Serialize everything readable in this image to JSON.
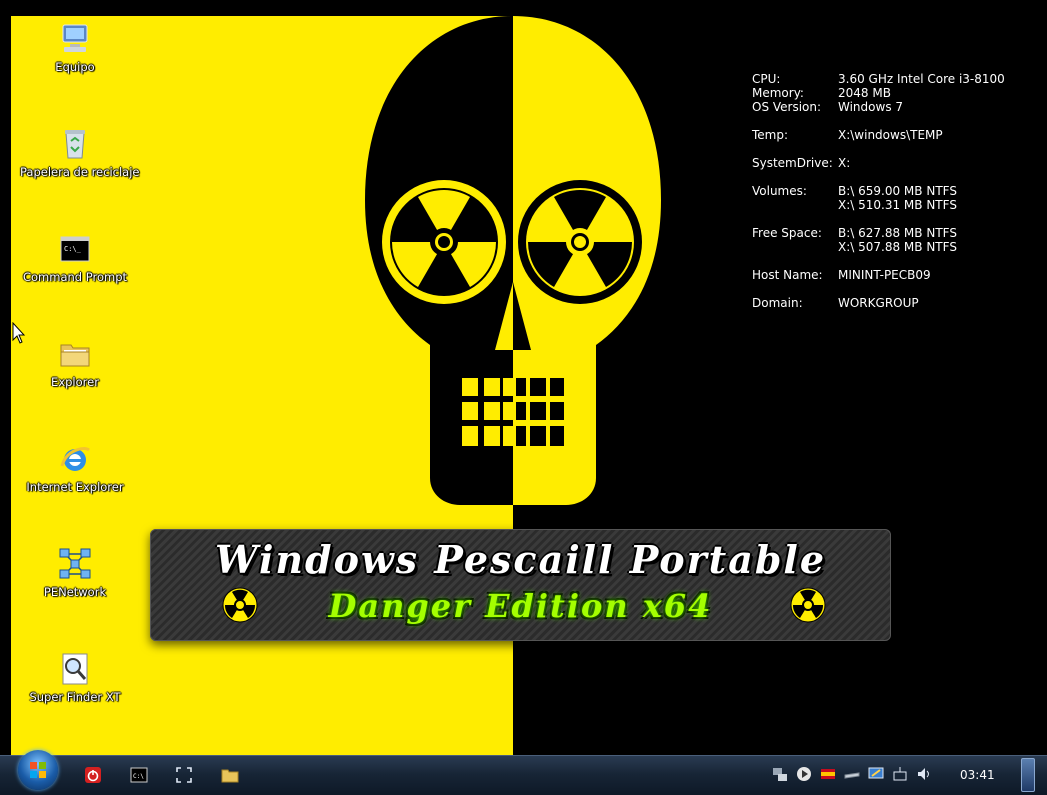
{
  "desktop": {
    "icons": [
      {
        "label": "Equipo",
        "icon": "computer-icon"
      },
      {
        "label": "Papelera de reciclaje",
        "icon": "recycle-bin-icon"
      },
      {
        "label": "Command Prompt",
        "icon": "cmd-icon"
      },
      {
        "label": "Explorer",
        "icon": "folder-icon"
      },
      {
        "label": "Internet Explorer",
        "icon": "ie-icon"
      },
      {
        "label": "PENetwork",
        "icon": "network-icon"
      },
      {
        "label": "Super Finder XT",
        "icon": "magnifier-icon"
      }
    ]
  },
  "sysinfo": {
    "cpu": {
      "label": "CPU:",
      "value": "3.60 GHz Intel Core i3-8100"
    },
    "memory": {
      "label": "Memory:",
      "value": "2048 MB"
    },
    "os": {
      "label": "OS Version:",
      "value": "Windows 7"
    },
    "temp": {
      "label": "Temp:",
      "value": "X:\\windows\\TEMP"
    },
    "systemdrive": {
      "label": "SystemDrive:",
      "value": "X:"
    },
    "volumes": {
      "label": "Volumes:",
      "value1": "B:\\ 659.00 MB NTFS",
      "value2": "X:\\ 510.31 MB NTFS"
    },
    "freespace": {
      "label": "Free Space:",
      "value1": "B:\\ 627.88 MB NTFS",
      "value2": "X:\\ 507.88 MB NTFS"
    },
    "hostname": {
      "label": "Host Name:",
      "value": "MININT-PECB09"
    },
    "domain": {
      "label": "Domain:",
      "value": "WORKGROUP"
    }
  },
  "banner": {
    "title": "Windows Pescaill Portable",
    "subtitle": "Danger Edition x64"
  },
  "taskbar": {
    "clock": "03:41",
    "pinned": [
      "shutdown-icon",
      "cmd-icon",
      "fullscreen-icon",
      "folder-icon"
    ],
    "tray": [
      "network-icon",
      "media-play-icon",
      "spain-flag-icon",
      "drive-icon",
      "display-icon",
      "wireless-icon",
      "volume-icon"
    ]
  },
  "colors": {
    "yellow": "#ffed00",
    "black": "#000000",
    "taskbar": "#172536",
    "banner_green": "#a4ff00"
  }
}
